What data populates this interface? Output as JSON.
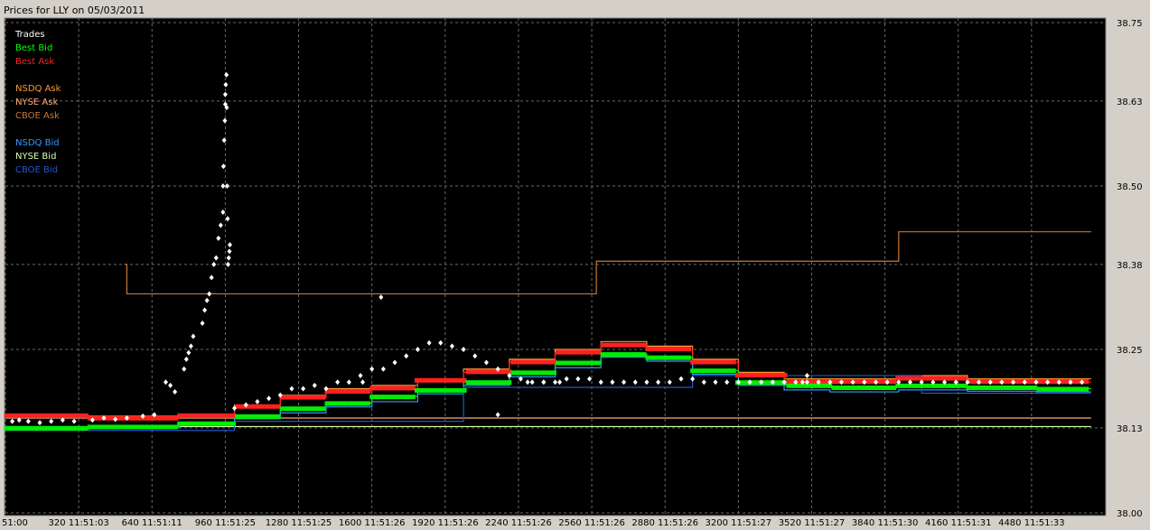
{
  "chart_data": {
    "type": "line",
    "title": "Prices for LLY on 05/03/2011",
    "xlabel": "",
    "ylabel": "",
    "ylim": [
      38.0,
      38.75
    ],
    "xlim": [
      0,
      4800
    ],
    "grid": true,
    "legend_position": "top-left",
    "y_ticks": [
      "38.75",
      "38.63",
      "38.50",
      "38.38",
      "38.25",
      "38.13",
      "38.00"
    ],
    "x_ticks": [
      {
        "x": 0,
        "label": "51:00"
      },
      {
        "x": 320,
        "label": "320 11:51:03"
      },
      {
        "x": 640,
        "label": "640 11:51:11"
      },
      {
        "x": 960,
        "label": "960 11:51:25"
      },
      {
        "x": 1280,
        "label": "1280 11:51:25"
      },
      {
        "x": 1600,
        "label": "1600 11:51:26"
      },
      {
        "x": 1920,
        "label": "1920 11:51:26"
      },
      {
        "x": 2240,
        "label": "2240 11:51:26"
      },
      {
        "x": 2560,
        "label": "2560 11:51:26"
      },
      {
        "x": 2880,
        "label": "2880 11:51:26"
      },
      {
        "x": 3200,
        "label": "3200 11:51:27"
      },
      {
        "x": 3520,
        "label": "3520 11:51:27"
      },
      {
        "x": 3840,
        "label": "3840 11:51:30"
      },
      {
        "x": 4160,
        "label": "4160 11:51:31"
      },
      {
        "x": 4480,
        "label": "4480 11:51:33"
      }
    ],
    "legend": [
      {
        "label": "Trades",
        "color": "#ffffff"
      },
      {
        "label": "Best Bid",
        "color": "#00ff00"
      },
      {
        "label": "Best Ask",
        "color": "#ff2020"
      },
      {
        "label": "",
        "color": "#000000"
      },
      {
        "label": "NSDQ Ask",
        "color": "#ff9933"
      },
      {
        "label": "NYSE Ask",
        "color": "#ffaa77"
      },
      {
        "label": "CBOE Ask",
        "color": "#c87830"
      },
      {
        "label": "",
        "color": "#000000"
      },
      {
        "label": "NSDQ Bid",
        "color": "#3399ff"
      },
      {
        "label": "NYSE Bid",
        "color": "#ddffaa"
      },
      {
        "label": "CBOE Bid",
        "color": "#2255cc"
      }
    ],
    "series": [
      {
        "name": "CBOE Ask",
        "color": "#c87830",
        "step": true,
        "x": [
          520,
          530,
          2580,
          3900,
          4740
        ],
        "y": [
          38.38,
          38.335,
          38.385,
          38.43,
          38.43
        ]
      },
      {
        "name": "NYSE Ask",
        "color": "#ffaa77",
        "step": false,
        "x": [
          0,
          4740
        ],
        "y": [
          38.145,
          38.145
        ]
      },
      {
        "name": "NYSE Bid",
        "color": "#ddffaa",
        "step": false,
        "x": [
          0,
          4740
        ],
        "y": [
          38.132,
          38.132
        ]
      },
      {
        "name": "NSDQ Ask",
        "color": "#ff9933",
        "step": true,
        "x": [
          0,
          360,
          760,
          1000,
          1200,
          1400,
          1600,
          1800,
          2000,
          2200,
          2400,
          2600,
          2800,
          3000,
          3200,
          3400,
          3600,
          3900,
          4200,
          4500,
          4740
        ],
        "y": [
          38.15,
          38.148,
          38.15,
          38.165,
          38.18,
          38.19,
          38.195,
          38.205,
          38.22,
          38.235,
          38.25,
          38.262,
          38.255,
          38.235,
          38.215,
          38.205,
          38.205,
          38.21,
          38.205,
          38.205,
          38.205
        ]
      },
      {
        "name": "Best Ask",
        "color": "#ff2020",
        "step": true,
        "x": [
          0,
          360,
          760,
          1000,
          1200,
          1400,
          1600,
          1800,
          2000,
          2200,
          2400,
          2600,
          2800,
          3000,
          3200,
          3400,
          3600,
          3900,
          4200,
          4500,
          4740
        ],
        "y": [
          38.148,
          38.144,
          38.148,
          38.162,
          38.176,
          38.185,
          38.19,
          38.202,
          38.215,
          38.23,
          38.245,
          38.256,
          38.25,
          38.23,
          38.21,
          38.2,
          38.2,
          38.205,
          38.2,
          38.2,
          38.2
        ]
      },
      {
        "name": "Best Bid",
        "color": "#00ff00",
        "step": true,
        "x": [
          0,
          360,
          760,
          1000,
          1200,
          1400,
          1600,
          1800,
          2000,
          2200,
          2400,
          2600,
          2800,
          3000,
          3200,
          3400,
          3600,
          3900,
          4200,
          4500,
          4740
        ],
        "y": [
          38.13,
          38.132,
          38.137,
          38.148,
          38.16,
          38.168,
          38.178,
          38.188,
          38.2,
          38.215,
          38.23,
          38.243,
          38.238,
          38.218,
          38.2,
          38.195,
          38.192,
          38.195,
          38.192,
          38.19,
          38.19
        ]
      },
      {
        "name": "NSDQ Bid",
        "color": "#3399ff",
        "step": true,
        "x": [
          0,
          360,
          760,
          1000,
          1200,
          1400,
          1600,
          1800,
          2000,
          2200,
          2400,
          2600,
          2800,
          3000,
          3200,
          3400,
          3600,
          3900,
          4200,
          4500,
          4740
        ],
        "y": [
          38.128,
          38.13,
          38.135,
          38.144,
          38.153,
          38.162,
          38.17,
          38.182,
          38.195,
          38.208,
          38.222,
          38.238,
          38.232,
          38.212,
          38.195,
          38.188,
          38.185,
          38.188,
          38.186,
          38.185,
          38.185
        ]
      },
      {
        "name": "CBOE Bid",
        "color": "#2255cc",
        "step": true,
        "x": [
          0,
          1000,
          2000,
          3000,
          4000,
          4740
        ],
        "y": [
          38.126,
          38.14,
          38.192,
          38.21,
          38.183,
          38.183
        ]
      }
    ],
    "trades": {
      "x": [
        30,
        60,
        100,
        150,
        200,
        250,
        300,
        380,
        430,
        480,
        530,
        600,
        650,
        700,
        720,
        740,
        780,
        790,
        800,
        810,
        820,
        860,
        870,
        880,
        890,
        900,
        910,
        920,
        930,
        940,
        950,
        950,
        952,
        955,
        958,
        960,
        960,
        962,
        965,
        966,
        968,
        970,
        972,
        975,
        978,
        980,
        1000,
        1050,
        1100,
        1150,
        1200,
        1250,
        1300,
        1350,
        1400,
        1450,
        1500,
        1550,
        1600,
        1650,
        1700,
        1750,
        1800,
        1850,
        1900,
        1950,
        2000,
        2050,
        2100,
        2150,
        2200,
        2250,
        2300,
        2350,
        2400,
        2450,
        2500,
        2550,
        2600,
        2650,
        2700,
        2750,
        2800,
        2850,
        2900,
        2950,
        3000,
        3050,
        3100,
        3150,
        3200,
        3250,
        3300,
        3350,
        3400,
        3450,
        3500,
        3550,
        3600,
        3650,
        3700,
        3750,
        3800,
        3850,
        3900,
        3950,
        4000,
        4050,
        4100,
        4150,
        4200,
        4250,
        4300,
        4350,
        4400,
        4450,
        4500,
        4550,
        4600,
        4650,
        4700,
        1560,
        2280,
        2350,
        2420,
        3480,
        3500,
        2150,
        1640
      ],
      "y": [
        38.14,
        38.142,
        38.14,
        38.138,
        38.14,
        38.142,
        38.14,
        38.142,
        38.145,
        38.143,
        38.145,
        38.148,
        38.15,
        38.2,
        38.195,
        38.185,
        38.22,
        38.235,
        38.245,
        38.255,
        38.27,
        38.29,
        38.31,
        38.325,
        38.335,
        38.36,
        38.38,
        38.39,
        38.42,
        38.44,
        38.46,
        38.5,
        38.53,
        38.57,
        38.6,
        38.625,
        38.64,
        38.655,
        38.67,
        38.62,
        38.5,
        38.45,
        38.38,
        38.39,
        38.4,
        38.41,
        38.16,
        38.165,
        38.17,
        38.175,
        38.18,
        38.19,
        38.19,
        38.195,
        38.19,
        38.2,
        38.2,
        38.21,
        38.22,
        38.22,
        38.23,
        38.24,
        38.25,
        38.26,
        38.26,
        38.255,
        38.25,
        38.24,
        38.23,
        38.22,
        38.21,
        38.205,
        38.2,
        38.2,
        38.2,
        38.205,
        38.205,
        38.205,
        38.2,
        38.2,
        38.2,
        38.2,
        38.2,
        38.2,
        38.2,
        38.205,
        38.205,
        38.2,
        38.2,
        38.2,
        38.2,
        38.2,
        38.2,
        38.2,
        38.2,
        38.2,
        38.2,
        38.2,
        38.2,
        38.2,
        38.2,
        38.2,
        38.2,
        38.2,
        38.2,
        38.2,
        38.2,
        38.2,
        38.2,
        38.2,
        38.2,
        38.2,
        38.2,
        38.2,
        38.2,
        38.2,
        38.2,
        38.2,
        38.2,
        38.2,
        38.2,
        38.2,
        38.2,
        38.2,
        38.2,
        38.2,
        38.21,
        38.15,
        38.33,
        38.17,
        38.21,
        38.15,
        38.145,
        38.195,
        38.18
      ]
    }
  }
}
